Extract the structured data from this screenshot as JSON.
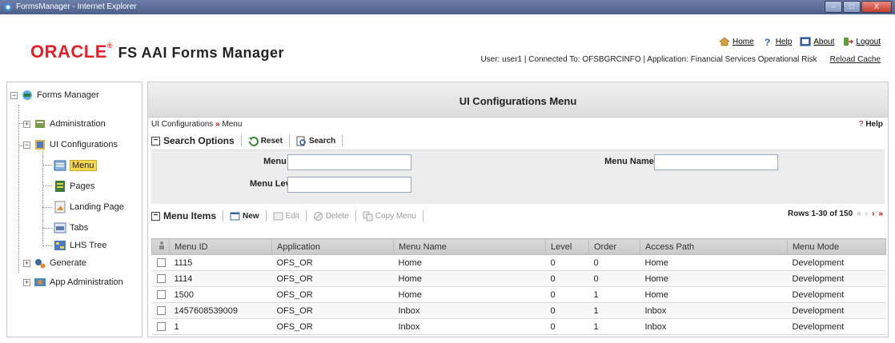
{
  "window": {
    "title": "FormsManager - Internet Explorer",
    "controls": [
      "–",
      "□",
      "X"
    ]
  },
  "header": {
    "brand_oracle": "ORACLE",
    "brand_mark": "®",
    "product": "FS AAI Forms Manager",
    "links": [
      {
        "label": "Home",
        "icon": "home-icon"
      },
      {
        "label": "Help",
        "icon": "help-icon"
      },
      {
        "label": "About",
        "icon": "about-icon"
      },
      {
        "label": "Logout",
        "icon": "logout-icon"
      }
    ],
    "userline": "User: user1  |  Connected To: OFSBGRCINFO  |  Application: Financial Services Operational Risk",
    "reload": "Reload Cache"
  },
  "tree": {
    "root": "Forms Manager",
    "items": [
      "Administration",
      "UI Configurations",
      "Menu",
      "Pages",
      "Landing Page",
      "Tabs",
      "LHS Tree",
      "Generate",
      "App Administration"
    ],
    "expander_plus": "+",
    "expander_minus": "−"
  },
  "main": {
    "title": "UI Configurations Menu",
    "crumb_parent": "UI Configurations",
    "crumb_sep": "»",
    "crumb_current": "Menu",
    "help_q": "?",
    "help_label": "Help",
    "search": {
      "toggle": "−",
      "title": "Search Options",
      "reset": "Reset",
      "search": "Search",
      "menu_id_label": "Menu ID",
      "menu_name_label": "Menu Name",
      "menu_level_label": "Menu Level",
      "q": "?"
    },
    "items": {
      "toggle": "−",
      "title": "Menu Items",
      "new": "New",
      "edit": "Edit",
      "delete": "Delete",
      "copy": "Copy Menu",
      "rows_label": "Rows 1-30 of 150",
      "nav_first": "«",
      "nav_prev": "‹",
      "nav_next": "›",
      "nav_last": "»"
    },
    "columns": [
      "Menu ID",
      "Application",
      "Menu Name",
      "Level",
      "Order",
      "Access Path",
      "Menu Mode"
    ],
    "rows": [
      [
        "1115",
        "OFS_OR",
        "Home",
        "0",
        "0",
        "Home",
        "Development"
      ],
      [
        "1114",
        "OFS_OR",
        "Home",
        "0",
        "0",
        "Home",
        "Development"
      ],
      [
        "1500",
        "OFS_OR",
        "Home",
        "0",
        "1",
        "Home",
        "Development"
      ],
      [
        "1457608539009",
        "OFS_OR",
        "Inbox",
        "0",
        "1",
        "Inbox",
        "Development"
      ],
      [
        "1",
        "OFS_OR",
        "Inbox",
        "0",
        "1",
        "Inbox",
        "Development"
      ]
    ]
  },
  "colors": {
    "oracle_red": "#e4202a",
    "selected": "#f5d84a",
    "panel": "#ececec"
  }
}
